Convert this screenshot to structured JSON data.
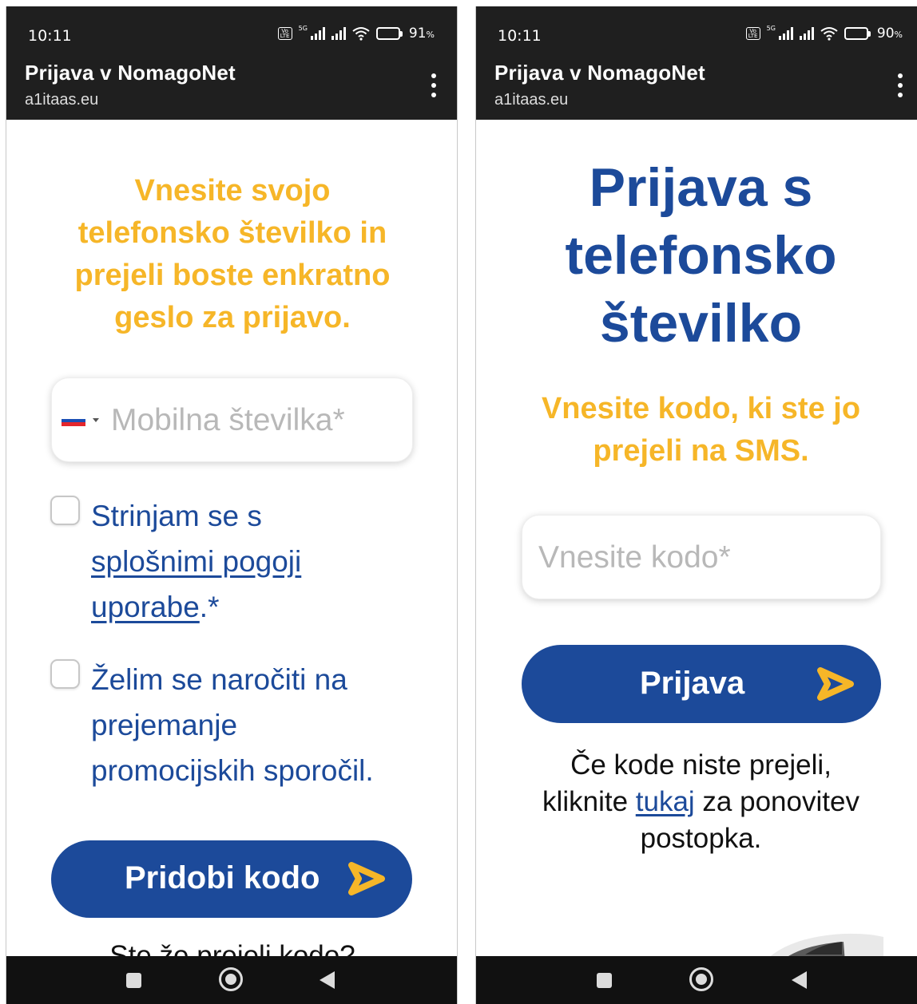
{
  "colors": {
    "yellow": "#f6b628",
    "blue": "#1c4a9a",
    "topbar": "#1f1f1f"
  },
  "left": {
    "status": {
      "time": "10:11",
      "volte": "Vo LTE",
      "net": "5G",
      "battery_pct": "91",
      "pct_sign": "%"
    },
    "appbar": {
      "title": "Prijava v NomagoNet",
      "url": "a1itaas.eu"
    },
    "heading_lines": [
      "Vnesite svojo",
      "telefonsko številko in",
      "prejeli boste enkratno",
      "geslo za prijavo."
    ],
    "phone_input": {
      "value": "",
      "placeholder": "Mobilna številka*",
      "country_flag": "slovenia-flag-icon"
    },
    "terms": {
      "prefix": "Strinjam se s ",
      "link_line1": "splošnimi pogoji",
      "link_line2": "uporabe",
      "suffix": ".*"
    },
    "newsletter": {
      "lines": [
        "Želim se naročiti na",
        "prejemanje",
        "promocijskih sporočil."
      ]
    },
    "submit": {
      "label": "Pridobi kodo"
    },
    "cut_text": "Ste že prejeli kodo?"
  },
  "right": {
    "status": {
      "time": "10:11",
      "volte": "Vo LTE",
      "net": "5G",
      "battery_pct": "90",
      "pct_sign": "%"
    },
    "appbar": {
      "title": "Prijava v NomagoNet",
      "url": "a1itaas.eu"
    },
    "title_lines": [
      "Prijava s",
      "telefonsko",
      "številko"
    ],
    "subtitle_lines": [
      "Vnesite kodo, ki ste jo",
      "prejeli na SMS."
    ],
    "code_input": {
      "value": "",
      "placeholder": "Vnesite kodo*"
    },
    "submit": {
      "label": "Prijava"
    },
    "resend": {
      "line1": "Če kode niste prejeli,",
      "prefix": "kliknite ",
      "link": "tukaj",
      "suffix": " za ponovitev",
      "line3": "postopka."
    }
  }
}
